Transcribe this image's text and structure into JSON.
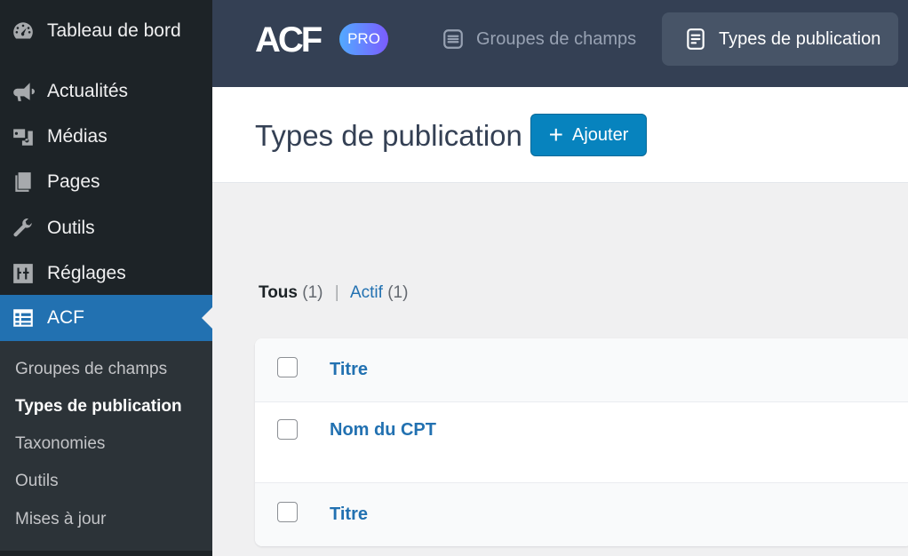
{
  "sidebar": {
    "items": [
      {
        "label": "Tableau de bord",
        "icon": "dashboard-icon"
      },
      {
        "label": "Actualités",
        "icon": "megaphone-icon"
      },
      {
        "label": "Médias",
        "icon": "media-icon"
      },
      {
        "label": "Pages",
        "icon": "pages-icon"
      },
      {
        "label": "Outils",
        "icon": "wrench-icon"
      },
      {
        "label": "Réglages",
        "icon": "settings-sliders-icon"
      },
      {
        "label": "ACF",
        "icon": "acf-table-icon"
      }
    ],
    "submenu": [
      {
        "label": "Groupes de champs"
      },
      {
        "label": "Types de publication"
      },
      {
        "label": "Taxonomies"
      },
      {
        "label": "Outils"
      },
      {
        "label": "Mises à jour"
      }
    ]
  },
  "header": {
    "logo": "ACF",
    "badge": "PRO",
    "nav": [
      {
        "label": "Groupes de champs",
        "icon": "field-groups-icon"
      },
      {
        "label": "Types de publication",
        "icon": "post-types-icon"
      }
    ]
  },
  "page": {
    "title": "Types de publication",
    "add_button": "Ajouter"
  },
  "filters": {
    "all_label": "Tous",
    "all_count": "(1)",
    "separator": "|",
    "active_label": "Actif",
    "active_count": "(1)"
  },
  "table": {
    "header_col": "Titre",
    "rows": [
      {
        "title": "Nom du CPT"
      }
    ],
    "footer_col": "Titre"
  },
  "colors": {
    "sidebar_bg": "#1d2327",
    "active_menu": "#2271b1",
    "acf_header": "#344054",
    "button": "#0783be",
    "link": "#2271b1"
  }
}
